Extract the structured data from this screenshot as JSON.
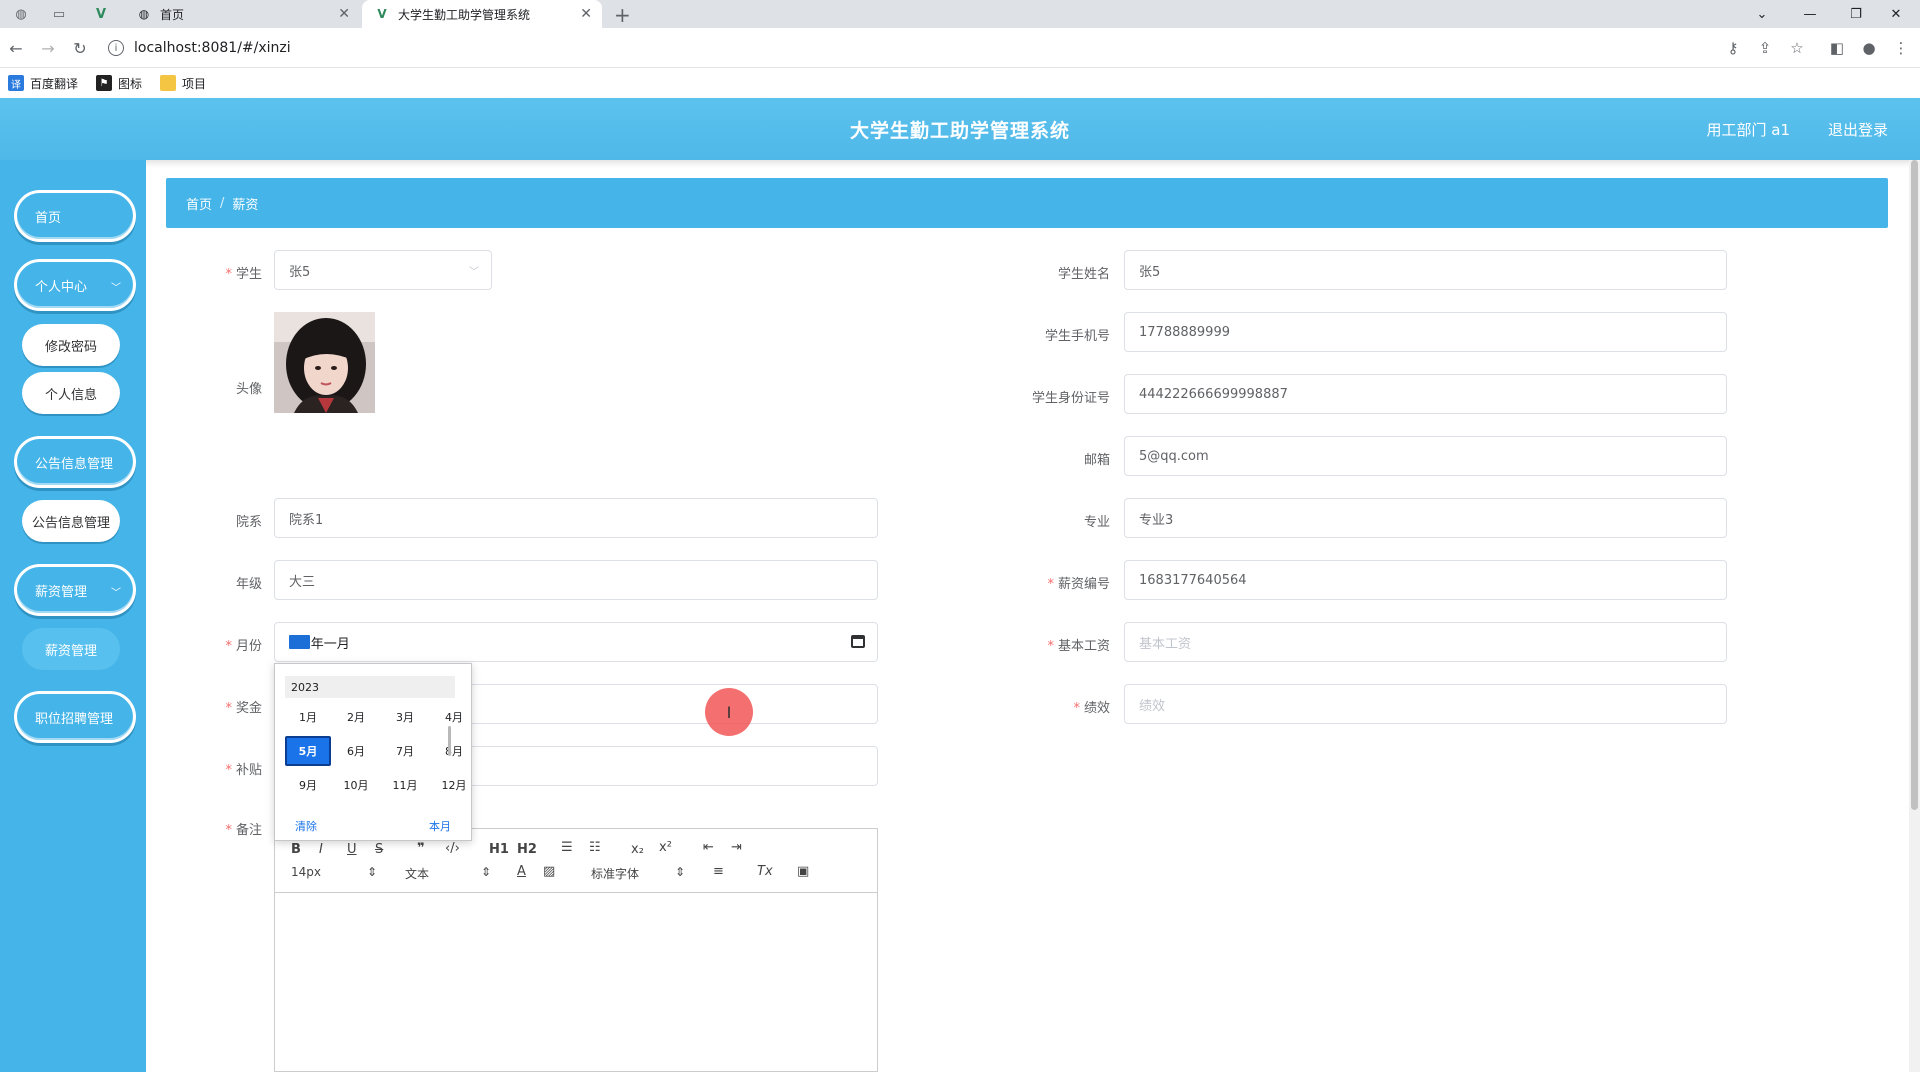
{
  "browser": {
    "tabs": [
      {
        "label": "首页",
        "active": false
      },
      {
        "label": "大学生勤工助学管理系统",
        "active": true
      }
    ],
    "url": "localhost:8081/#/xinzi",
    "bookmarks": [
      "百度翻译",
      "图标",
      "项目"
    ]
  },
  "header": {
    "title": "大学生勤工助学管理系统",
    "user": "用工部门 a1",
    "logout": "退出登录"
  },
  "sidebar": {
    "home": "首页",
    "personal_center": "个人中心",
    "change_password": "修改密码",
    "personal_info": "个人信息",
    "notice_mgmt": "公告信息管理",
    "notice_mgmt_sub": "公告信息管理",
    "salary_mgmt": "薪资管理",
    "salary_mgmt_sub": "薪资管理",
    "job_mgmt": "职位招聘管理"
  },
  "breadcrumb": {
    "home": "首页",
    "separator": "/",
    "current": "薪资"
  },
  "form": {
    "student": {
      "label": "学生",
      "value": "张5"
    },
    "avatar": {
      "label": "头像"
    },
    "department": {
      "label": "院系",
      "value": "院系1"
    },
    "grade": {
      "label": "年级",
      "value": "大三"
    },
    "month": {
      "label": "月份",
      "value_suffix": "年一月",
      "selected_part": "----"
    },
    "bonus": {
      "label": "奖金"
    },
    "allowance": {
      "label": "补贴"
    },
    "remark": {
      "label": "备注"
    },
    "student_name": {
      "label": "学生姓名",
      "value": "张5"
    },
    "student_phone": {
      "label": "学生手机号",
      "value": "17788889999"
    },
    "student_id": {
      "label": "学生身份证号",
      "value": "444222666699998887"
    },
    "email": {
      "label": "邮箱",
      "value": "5@qq.com"
    },
    "major": {
      "label": "专业",
      "value": "专业3"
    },
    "salary_no": {
      "label": "薪资编号",
      "value": "1683177640564"
    },
    "base_salary": {
      "label": "基本工资",
      "placeholder": "基本工资"
    },
    "performance": {
      "label": "绩效",
      "placeholder": "绩效"
    }
  },
  "month_picker": {
    "year": "2023",
    "months": [
      "1月",
      "2月",
      "3月",
      "4月",
      "5月",
      "6月",
      "7月",
      "8月",
      "9月",
      "10月",
      "11月",
      "12月"
    ],
    "selected": "5月",
    "clear": "清除",
    "this_month": "本月"
  },
  "editor": {
    "font_size": "14px",
    "block_format": "文本",
    "font_family": "标准字体",
    "h1": "H1",
    "h2": "H2"
  },
  "colors": {
    "accent": "#45b4e8",
    "required": "#f56c6c",
    "picker_selected": "#1a73e8"
  }
}
